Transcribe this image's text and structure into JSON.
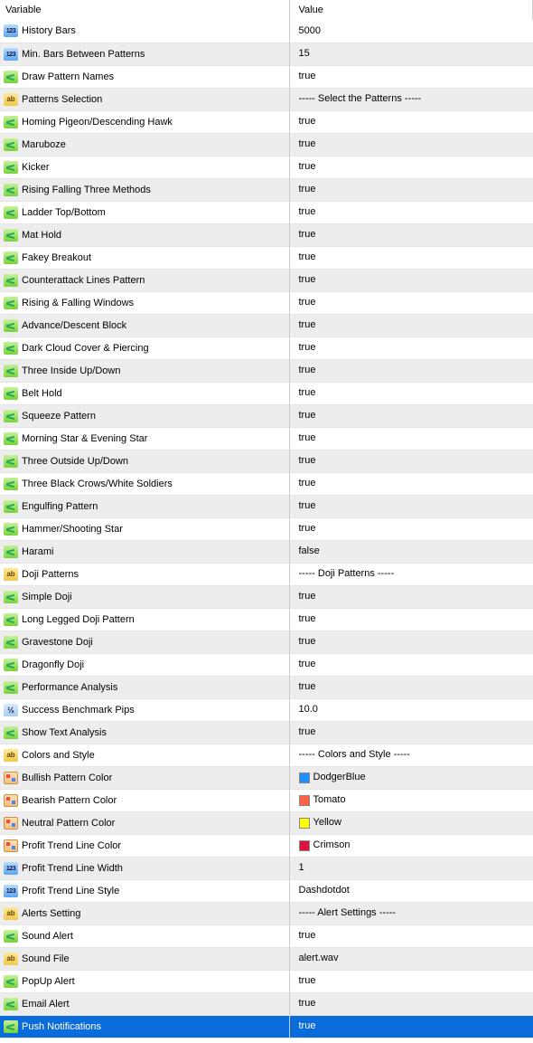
{
  "headers": {
    "variable": "Variable",
    "value": "Value"
  },
  "rows": [
    {
      "icon": "num",
      "name": "History Bars",
      "value": "5000"
    },
    {
      "icon": "num",
      "name": "Min. Bars Between Patterns",
      "value": "15"
    },
    {
      "icon": "bool",
      "name": "Draw Pattern Names",
      "value": "true"
    },
    {
      "icon": "str",
      "name": "Patterns Selection",
      "value": "----- Select the Patterns -----"
    },
    {
      "icon": "bool",
      "name": "Homing Pigeon/Descending Hawk",
      "value": "true"
    },
    {
      "icon": "bool",
      "name": "Maruboze",
      "value": "true"
    },
    {
      "icon": "bool",
      "name": "Kicker",
      "value": "true"
    },
    {
      "icon": "bool",
      "name": "Rising Falling Three Methods",
      "value": "true"
    },
    {
      "icon": "bool",
      "name": "Ladder Top/Bottom",
      "value": "true"
    },
    {
      "icon": "bool",
      "name": "Mat Hold",
      "value": "true"
    },
    {
      "icon": "bool",
      "name": "Fakey Breakout",
      "value": "true"
    },
    {
      "icon": "bool",
      "name": "Counterattack Lines Pattern",
      "value": "true"
    },
    {
      "icon": "bool",
      "name": "Rising & Falling Windows",
      "value": "true"
    },
    {
      "icon": "bool",
      "name": "Advance/Descent Block",
      "value": "true"
    },
    {
      "icon": "bool",
      "name": "Dark Cloud Cover & Piercing",
      "value": "true"
    },
    {
      "icon": "bool",
      "name": "Three Inside Up/Down",
      "value": "true"
    },
    {
      "icon": "bool",
      "name": "Belt Hold",
      "value": "true"
    },
    {
      "icon": "bool",
      "name": "Squeeze Pattern",
      "value": "true"
    },
    {
      "icon": "bool",
      "name": "Morning Star & Evening Star",
      "value": "true"
    },
    {
      "icon": "bool",
      "name": "Three Outside Up/Down",
      "value": "true"
    },
    {
      "icon": "bool",
      "name": "Three Black Crows/White Soldiers",
      "value": "true"
    },
    {
      "icon": "bool",
      "name": "Engulfing Pattern",
      "value": "true"
    },
    {
      "icon": "bool",
      "name": "Hammer/Shooting Star",
      "value": "true"
    },
    {
      "icon": "bool",
      "name": "Harami",
      "value": "false"
    },
    {
      "icon": "str",
      "name": "Doji Patterns",
      "value": "----- Doji Patterns -----"
    },
    {
      "icon": "bool",
      "name": "Simple Doji",
      "value": "true"
    },
    {
      "icon": "bool",
      "name": "Long Legged Doji Pattern",
      "value": "true"
    },
    {
      "icon": "bool",
      "name": "Gravestone Doji",
      "value": "true"
    },
    {
      "icon": "bool",
      "name": "Dragonfly Doji",
      "value": "true"
    },
    {
      "icon": "bool",
      "name": "Performance Analysis",
      "value": "true"
    },
    {
      "icon": "float",
      "name": "Success Benchmark Pips",
      "value": "10.0"
    },
    {
      "icon": "bool",
      "name": "Show Text Analysis",
      "value": "true"
    },
    {
      "icon": "str",
      "name": "Colors and Style",
      "value": "----- Colors and Style -----"
    },
    {
      "icon": "color",
      "name": "Bullish Pattern Color",
      "value": "DodgerBlue",
      "swatch": "#1e90ff"
    },
    {
      "icon": "color",
      "name": "Bearish Pattern Color",
      "value": "Tomato",
      "swatch": "#ff6347"
    },
    {
      "icon": "color",
      "name": "Neutral Pattern Color",
      "value": "Yellow",
      "swatch": "#ffff00"
    },
    {
      "icon": "color",
      "name": "Profit Trend Line Color",
      "value": "Crimson",
      "swatch": "#dc143c"
    },
    {
      "icon": "num",
      "name": "Profit Trend Line Width",
      "value": "1"
    },
    {
      "icon": "num",
      "name": "Profit Trend Line Style",
      "value": "Dashdotdot"
    },
    {
      "icon": "str",
      "name": "Alerts Setting",
      "value": "----- Alert Settings -----"
    },
    {
      "icon": "bool",
      "name": "Sound Alert",
      "value": "true"
    },
    {
      "icon": "str",
      "name": "Sound File",
      "value": "alert.wav"
    },
    {
      "icon": "bool",
      "name": "PopUp Alert",
      "value": "true"
    },
    {
      "icon": "bool",
      "name": "Email Alert",
      "value": "true"
    },
    {
      "icon": "bool",
      "name": "Push Notifications",
      "value": "true",
      "selected": true
    }
  ]
}
